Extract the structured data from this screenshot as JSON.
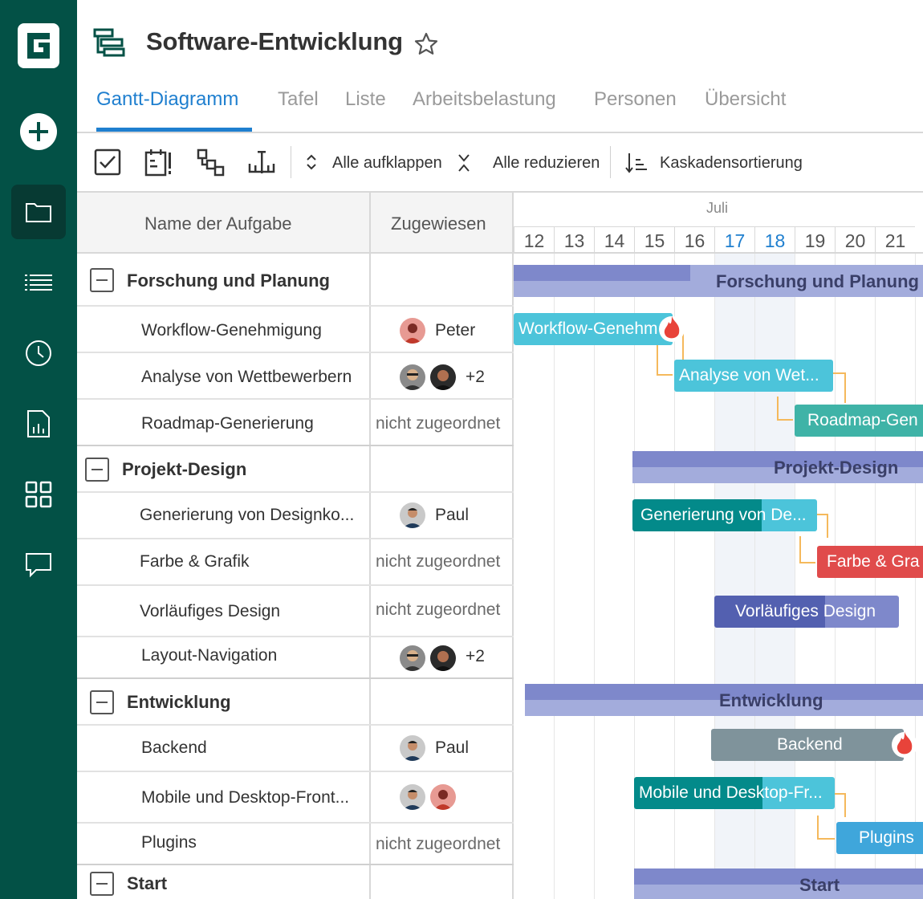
{
  "colors": {
    "sidebar": "#035146",
    "accent": "#1f7fcf",
    "group_bar": "#7e88cb",
    "teal_bar": "#4cc4da",
    "dark_teal_bar": "#038a8a",
    "red_bar": "#e04b4b",
    "indigo_bar": "#5360b0",
    "gray_bar": "#7f939b",
    "blue_bar": "#3fa6db",
    "green_bar": "#3fb3a7",
    "link": "#f5b95c"
  },
  "sidebar": {
    "items": [
      {
        "icon": "logo-g-icon"
      },
      {
        "icon": "add-circle-icon"
      },
      {
        "icon": "folder-icon",
        "active": true
      },
      {
        "icon": "list-icon"
      },
      {
        "icon": "clock-icon"
      },
      {
        "icon": "report-icon"
      },
      {
        "icon": "grid-icon"
      },
      {
        "icon": "chat-icon"
      }
    ]
  },
  "header": {
    "title": "Software-Entwicklung",
    "icon": "gantt-project-icon",
    "star_icon": "star-icon"
  },
  "tabs": [
    {
      "label": "Gantt-Diagramm",
      "active": true
    },
    {
      "label": "Tafel"
    },
    {
      "label": "Liste"
    },
    {
      "label": "Arbeitsbelastung"
    },
    {
      "label": "Personen"
    },
    {
      "label": "Übersicht"
    }
  ],
  "toolbar": {
    "expand_all": "Alle aufklappen",
    "collapse_all": "Alle reduzieren",
    "cascade_sort": "Kaskadensortierung"
  },
  "grid": {
    "col_name": "Name der Aufgabe",
    "col_assigned": "Zugewiesen"
  },
  "timeline": {
    "month": "Juli",
    "days": [
      "12",
      "13",
      "14",
      "15",
      "16",
      "17",
      "18",
      "19",
      "20",
      "21"
    ],
    "highlighted_days": [
      "17",
      "18"
    ]
  },
  "rows": [
    {
      "type": "group",
      "name": "Forschung und Planung"
    },
    {
      "type": "task",
      "name": "Workflow-Genehmigung",
      "assignee": "Peter"
    },
    {
      "type": "task",
      "name": "Analyse von Wettbewerbern",
      "extra": "+2"
    },
    {
      "type": "task",
      "name": "Roadmap-Generierung",
      "unassigned": "nicht zugeordnet"
    },
    {
      "type": "group",
      "name": "Projekt-Design"
    },
    {
      "type": "task",
      "name": "Generierung von Designko...",
      "assignee": "Paul"
    },
    {
      "type": "task",
      "name": "Farbe & Grafik",
      "unassigned": "nicht zugeordnet"
    },
    {
      "type": "task",
      "name": "Vorläufiges Design",
      "unassigned": "nicht zugeordnet"
    },
    {
      "type": "task",
      "name": "Layout-Navigation",
      "extra": "+2"
    },
    {
      "type": "group",
      "name": "Entwicklung"
    },
    {
      "type": "task",
      "name": "Backend",
      "assignee": "Paul"
    },
    {
      "type": "task",
      "name": "Mobile und Desktop-Front..."
    },
    {
      "type": "task",
      "name": "Plugins",
      "unassigned": "nicht zugeordnet"
    },
    {
      "type": "group",
      "name": "Start"
    }
  ],
  "bars": {
    "g1": "Forschung und Planung",
    "t1": "Workflow-Genehm",
    "t2": "Analyse von Wet...",
    "t3": "Roadmap-Gen",
    "g2": "Projekt-Design",
    "t4": "Generierung von De...",
    "t5": "Farbe & Gra",
    "t6": "Vorläufiges Design",
    "g3": "Entwicklung",
    "t7": "Backend",
    "t8": "Mobile und Desktop-Fr...",
    "t9": "Plugins",
    "g4": "Start"
  }
}
